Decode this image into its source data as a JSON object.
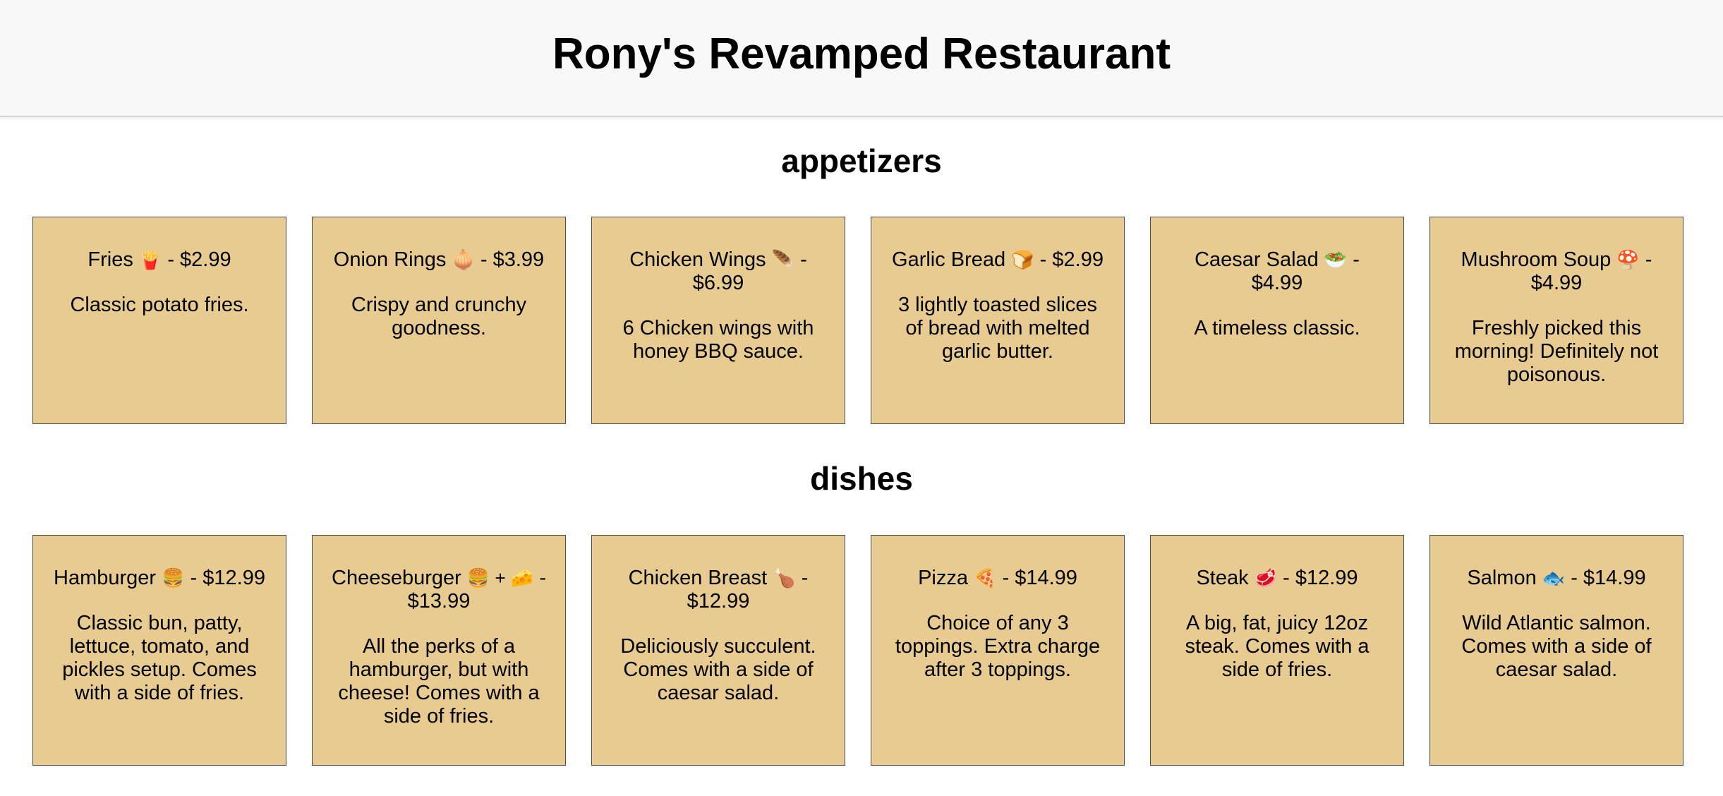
{
  "header": {
    "title": "Rony's Revamped Restaurant"
  },
  "sections": [
    {
      "title": "appetizers",
      "items": [
        {
          "name": "Fries",
          "emoji": "🍟",
          "price": "$2.99",
          "description": "Classic potato fries."
        },
        {
          "name": "Onion Rings",
          "emoji": "🧅",
          "price": "$3.99",
          "description": "Crispy and crunchy goodness."
        },
        {
          "name": "Chicken Wings",
          "emoji": "🪶",
          "price": "$6.99",
          "description": "6 Chicken wings with honey BBQ sauce."
        },
        {
          "name": "Garlic Bread",
          "emoji": "🍞",
          "price": "$2.99",
          "description": "3 lightly toasted slices of bread with melted garlic butter."
        },
        {
          "name": "Caesar Salad",
          "emoji": "🥗",
          "price": "$4.99",
          "description": "A timeless classic."
        },
        {
          "name": "Mushroom Soup",
          "emoji": "🍄",
          "price": "$4.99",
          "description": "Freshly picked this morning! Definitely not poisonous."
        }
      ]
    },
    {
      "title": "dishes",
      "items": [
        {
          "name": "Hamburger",
          "emoji": "🍔",
          "price": "$12.99",
          "description": "Classic bun, patty, lettuce, tomato, and pickles setup. Comes with a side of fries."
        },
        {
          "name": "Cheeseburger",
          "emoji": "🍔 + 🧀",
          "price": "$13.99",
          "description": "All the perks of a hamburger, but with cheese! Comes with a side of fries."
        },
        {
          "name": "Chicken Breast",
          "emoji": "🍗",
          "price": "$12.99",
          "description": "Deliciously succulent. Comes with a side of caesar salad."
        },
        {
          "name": "Pizza",
          "emoji": "🍕",
          "price": "$14.99",
          "description": "Choice of any 3 toppings. Extra charge after 3 toppings."
        },
        {
          "name": "Steak",
          "emoji": "🥩",
          "price": "$12.99",
          "description": "A big, fat, juicy 12oz steak. Comes with a side of fries."
        },
        {
          "name": "Salmon",
          "emoji": "🐟",
          "price": "$14.99",
          "description": "Wild Atlantic salmon. Comes with a side of caesar salad."
        }
      ]
    }
  ]
}
